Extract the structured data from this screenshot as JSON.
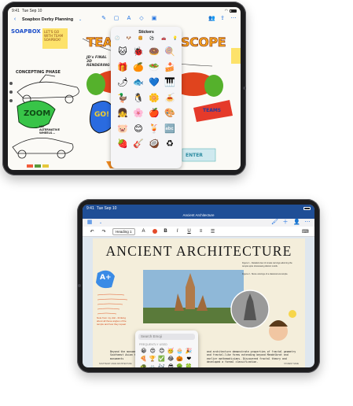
{
  "freeform": {
    "status_time": "9:41",
    "status_date": "Tue Sep 10",
    "board_title": "Soapbox Derby Planning",
    "canvas": {
      "banner_left": "TEAM",
      "banner_right": "SCOPE",
      "note_top_left": "LET'S GO WITH TEAM SOAPBOX!",
      "concepting_label": "CONCEPTING PHASE",
      "note_final": "JD's FINAL 3D RENDERING",
      "zoom_label": "ZOOM",
      "go_label": "GO!",
      "teams_label": "TEAMS",
      "enter_label": "ENTER",
      "logo_left": "SOAPBOX",
      "note_bottom_left": "NO ALTERNATIVE WHEELS..."
    },
    "stickers_panel": {
      "title": "Stickers",
      "categories": [
        "🕘",
        "🐶",
        "🍔",
        "⚽",
        "🚗",
        "💡"
      ],
      "items": [
        "🐱",
        "🐞",
        "🍩",
        "🍭",
        "🎁",
        "🍊",
        "🥗",
        "🍰",
        "🌶",
        "🐟",
        "💙",
        "🎹",
        "🦆",
        "🐧",
        "🌼",
        "🍝",
        "👧",
        "🌸",
        "🍎",
        "🎨",
        "🐷",
        "😊",
        "🍹",
        "🔤",
        "🍓",
        "🎸",
        "🥥",
        "♻"
      ]
    }
  },
  "pages": {
    "status_time": "9:41",
    "status_date": "Tue Sep 10",
    "document_name": "Ancient Architecture",
    "toolbar": {
      "style_chip": "Heading 1",
      "bold": "B",
      "italic": "I",
      "underline": "U"
    },
    "doc": {
      "heading": "ANCIENT ARCHITECTURE",
      "side_note_1": "Figure 1 - Detailed view of ornate carvings adorning the temple spire showcasing distinct motifs.",
      "side_note_2": "Figure 2 - Stone carvings of a classical era temple.",
      "body_left": "Beyond the monumental scale, Southeast Asian temples and monuments",
      "body_right": "and architecture demonstrate properties of fractal geometry and fractal-like forms extending beyond Mandelbrot and earlier mathematicians. Discovered fractal theory and developed a formal classification.",
      "footer_left": "SOUTHEAST ASIAN ARCHITECTURE",
      "footer_right": "STUDENT NAME",
      "handwritten_note": "Note from my visit - thinking about all these angles of the temple and how they repeat",
      "sticker_label": "A+"
    },
    "emoji_picker": {
      "search_placeholder": "Search Emoji",
      "section_label": "FREQUENTLY USED",
      "emojis": [
        "😀",
        "😍",
        "😊",
        "🥳",
        "🧁",
        "🎉",
        "🍕",
        "🏆",
        "✅",
        "😂",
        "🎃",
        "❤",
        "🐢",
        "🚲",
        "🎶",
        "😎",
        "🌳",
        "🍀",
        "🤩",
        "👍",
        "💡",
        "😺",
        "🎈",
        "⭐",
        "🍦",
        "🌈",
        "🔥",
        "✨",
        "🐝",
        "👀"
      ],
      "categories": [
        "⌨",
        "🕘",
        "😀",
        "🐶",
        "🍔",
        "⚽",
        "🚗",
        "💡",
        "🔣",
        "🏳"
      ]
    }
  },
  "colors": {
    "accent_blue": "#1b6fe0",
    "pages_header": "#1f4e96",
    "banner_orange": "#f6a21a"
  }
}
